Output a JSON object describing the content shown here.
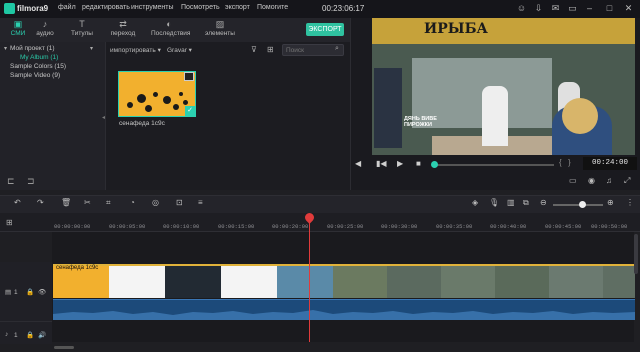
{
  "app": {
    "name": "filmora9",
    "timecode": "00:23:06:17"
  },
  "menu": [
    "файл",
    "редактировать",
    "инструменты",
    "Посмотреть",
    "экспорт",
    "Помогите"
  ],
  "window_icons": [
    "user-icon",
    "download-icon",
    "envelope-icon",
    "fullscreen-icon",
    "minimize-icon",
    "maximize-icon",
    "close-icon"
  ],
  "tabs": [
    {
      "label": "СМИ",
      "icon": "folder-icon",
      "active": true
    },
    {
      "label": "аудио",
      "icon": "music-note-icon",
      "active": false
    },
    {
      "label": "Титулы",
      "icon": "text-icon",
      "active": false
    },
    {
      "label": "переход",
      "icon": "transition-icon",
      "active": false
    },
    {
      "label": "Последствия",
      "icon": "effects-icon",
      "active": false
    },
    {
      "label": "элементы",
      "icon": "elements-icon",
      "active": false
    }
  ],
  "export_label": "ЭКСПОРТ",
  "tree": [
    {
      "label": "Мой проект (1)"
    },
    {
      "label": "My Album (1)"
    },
    {
      "label": "Sample Colors (15)"
    },
    {
      "label": "Sample Video (9)"
    }
  ],
  "media": {
    "filter1": "импортировать",
    "filter2": "Gravar",
    "search_placeholder": "Поиск",
    "thumb_label": "сенафеда 1с9с"
  },
  "preview": {
    "sign_text": "ИРЫБА",
    "caption_lines": [
      "ДЯНЬ ВИВЕ",
      "ПИРОЖКИ"
    ],
    "time": "00:24:00"
  },
  "ruler_labels": [
    "00:00:00:00",
    "00:00:05:00",
    "00:00:10:00",
    "00:00:15:00",
    "00:00:20:00",
    "00:00:25:00",
    "00:00:30:00",
    "00:00:35:00",
    "00:00:40:00",
    "00:00:45:00",
    "00:00:50:00"
  ],
  "tracks": {
    "video_label": "1",
    "audio_label": "1",
    "clip_title": "сенафеда 1с9с"
  },
  "colors": {
    "accent": "#2bd0b0",
    "playhead": "#e03b3b",
    "clip_border": "#e0b23a",
    "audio": "#1c4a7a"
  }
}
